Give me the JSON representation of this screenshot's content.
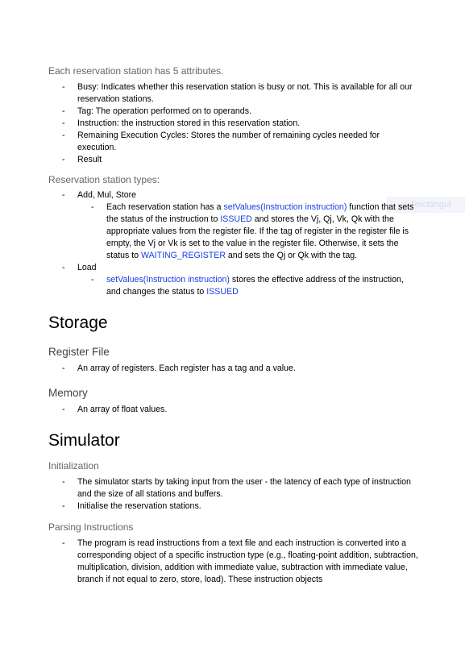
{
  "rs_intro": "Each reservation station has 5 attributes.",
  "attributes": [
    "Busy: Indicates whether this reservation station is busy or not. This is available for all our reservation stations.",
    "Tag: The operation performed on to operands.",
    "Instruction: the instruction stored in this reservation station.",
    "Remaining Execution Cycles: Stores the number of remaining cycles needed for execution.",
    "Result"
  ],
  "rs_types_heading": "Reservation station types:",
  "types": {
    "arith_label": "Add, Mul, Store",
    "arith": {
      "t1": "Each reservation station has a ",
      "fn": "setValues(Instruction instruction)",
      "t2": " function that sets the status of the instruction to ",
      "issued": "ISSUED",
      "t3": " and stores the Vj, Qj, Vk, Qk with the appropriate values from the register file. If the tag of register in the register file is empty, the Vj or Vk is set to the value in the register file. Otherwise, it sets the status to ",
      "waiting": "WAITING_REGISTER",
      "t4": " and sets the Qj or Qk with the tag."
    },
    "load_label": "Load",
    "load": {
      "fn": "setValues(Instruction instruction)",
      "t1": " stores the effective address of the instruction, and changes the status to ",
      "issued": "ISSUED"
    }
  },
  "storage": {
    "title": "Storage",
    "register_file_heading": "Register File",
    "register_file_item": "An array of registers. Each register has a tag and a value.",
    "memory_heading": "Memory",
    "memory_item": "An array of float values."
  },
  "simulator": {
    "title": "Simulator",
    "init_heading": "Initialization",
    "init_items": [
      "The simulator starts by taking input from the user - the latency of each type of instruction and the size of all stations and buffers.",
      "Initialise the reservation stations."
    ],
    "parsing_heading": "Parsing Instructions",
    "parsing_item": "The program is read instructions from a text file and each instruction is converted into a corresponding object of a specific instruction type (e.g., floating-point addition, subtraction, multiplication, division, addition with immediate value, subtraction with immediate value, branch if not equal to zero, store, load). These instruction objects"
  },
  "watermark": "Rectangul",
  "colors": {
    "text": "#000000",
    "subheading": "#666666",
    "link": "#1a3de0"
  }
}
